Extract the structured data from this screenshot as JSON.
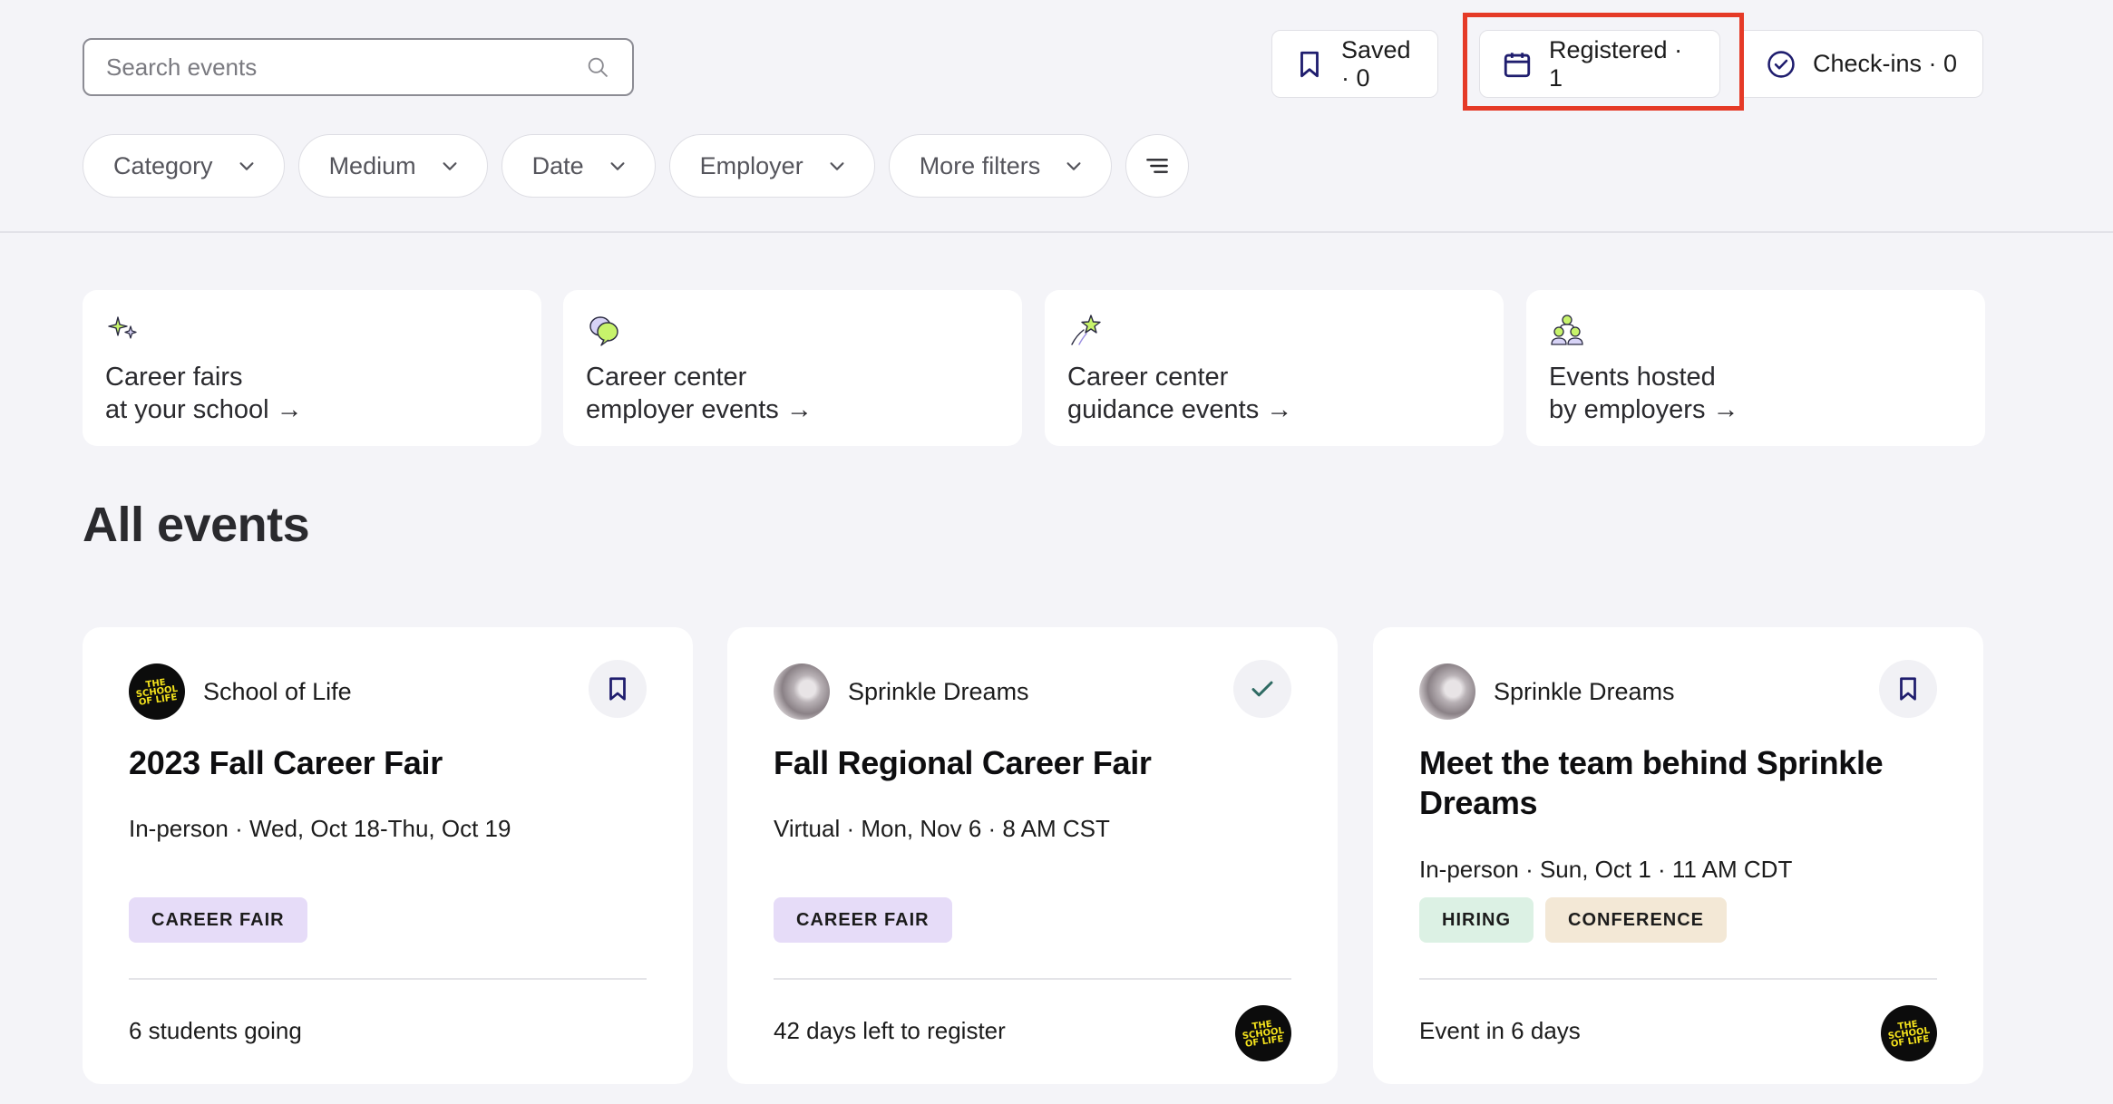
{
  "search": {
    "placeholder": "Search events",
    "value": ""
  },
  "counters": {
    "saved": "Saved · 0",
    "registered": "Registered · 1",
    "checkins": "Check-ins · 0"
  },
  "filters": [
    "Category",
    "Medium",
    "Date",
    "Employer",
    "More filters"
  ],
  "quick_links": [
    {
      "line1": "Career fairs",
      "line2": "at your school →"
    },
    {
      "line1": "Career center",
      "line2": "employer events →"
    },
    {
      "line1": "Career center",
      "line2": "guidance events →"
    },
    {
      "line1": "Events hosted",
      "line2": "by employers →"
    }
  ],
  "heading": "All events",
  "events": [
    {
      "org": "School of Life",
      "title": "2023 Fall Career Fair",
      "meta": "In-person · Wed, Oct 18-Thu, Oct 19",
      "tags": [
        "CAREER FAIR"
      ],
      "footer": "6 students going",
      "action": "bookmark-icon"
    },
    {
      "org": "Sprinkle Dreams",
      "title": "Fall Regional Career Fair",
      "meta": "Virtual · Mon, Nov 6 · 8 AM CST",
      "tags": [
        "CAREER FAIR"
      ],
      "footer": "42 days left to register",
      "action": "check-icon"
    },
    {
      "org": "Sprinkle Dreams",
      "title": "Meet the team behind Sprinkle Dreams",
      "meta": "In-person · Sun, Oct 1 · 11 AM CDT",
      "tags": [
        "HIRING",
        "CONFERENCE"
      ],
      "footer": "Event in 6 days",
      "action": "bookmark-icon"
    }
  ],
  "logo_text": "THE SCHOOL OF LIFE",
  "colors": {
    "accent": "#1f1d6e",
    "highlight": "#e53a27",
    "tag_purple": "#e6dcf8",
    "tag_green": "#dcf1e4",
    "tag_beige": "#f3e8d6",
    "logo_yellow": "#f4e21c"
  }
}
